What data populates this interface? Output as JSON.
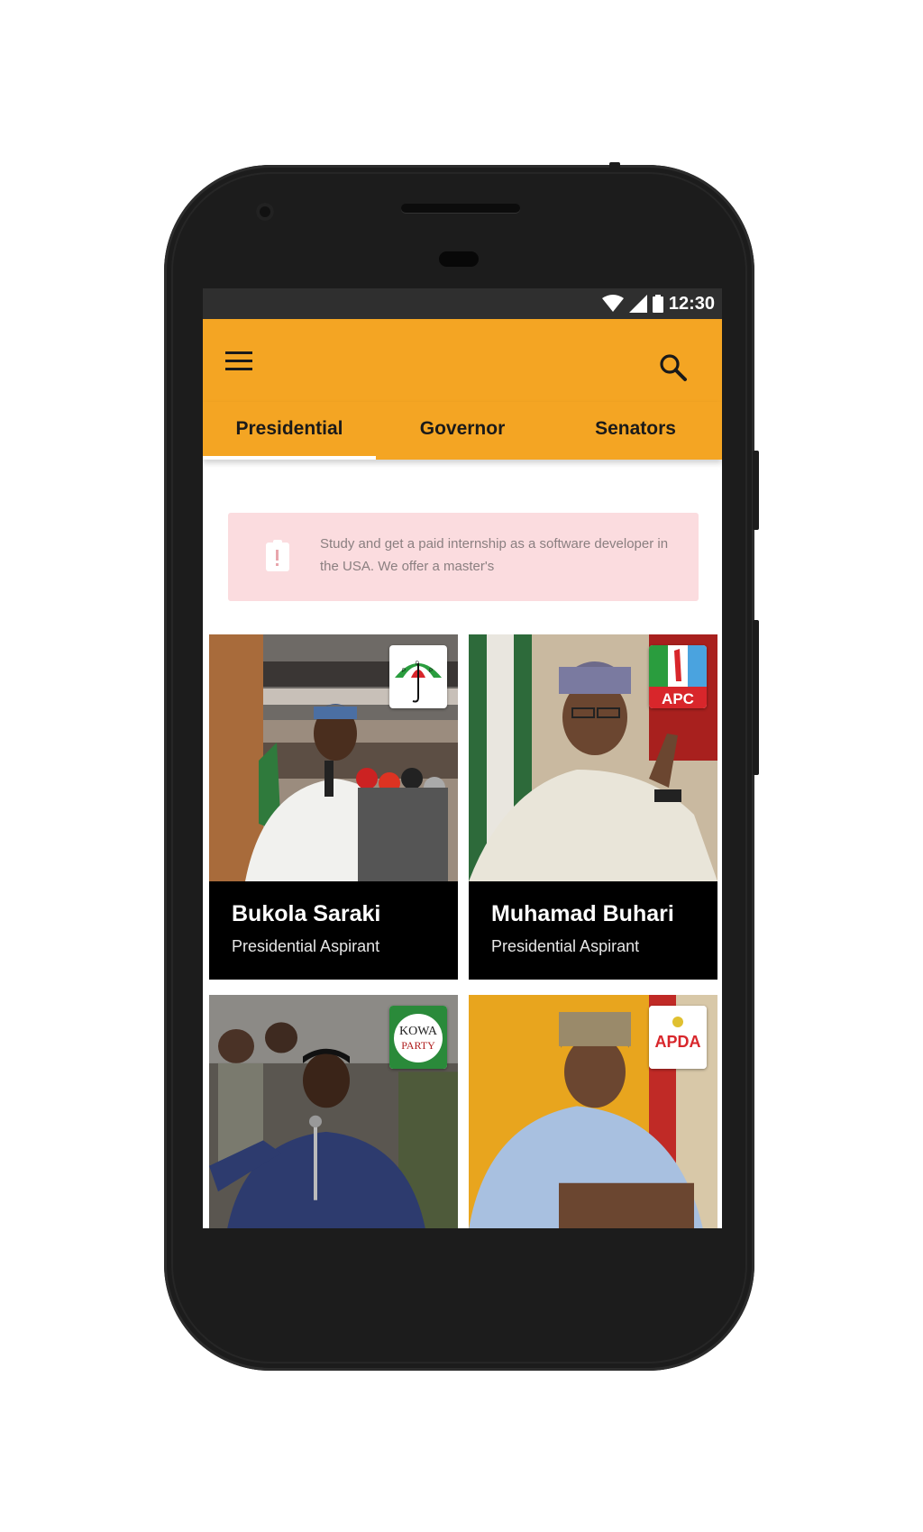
{
  "status_bar": {
    "time": "12:30",
    "icons": [
      "wifi-icon",
      "cell-signal-icon",
      "battery-icon"
    ]
  },
  "app_bar": {
    "background": "#f4a523",
    "menu_icon": "menu-icon",
    "search_icon": "search-icon"
  },
  "tabs": [
    {
      "label": "Presidential",
      "active": true
    },
    {
      "label": "Governor",
      "active": false
    },
    {
      "label": "Senators",
      "active": false
    }
  ],
  "ad": {
    "icon": "alert-clipboard-icon",
    "text": "Study and get a paid internship as a software developer in the USA. We offer a master's"
  },
  "candidates": [
    {
      "name": "Bukola Saraki",
      "role": "Presidential Aspirant",
      "party": "PDP"
    },
    {
      "name": "Muhamad Buhari",
      "role": "Presidential Aspirant",
      "party": "APC"
    },
    {
      "name": "",
      "role": "",
      "party": "KOWA PARTY",
      "party_line1": "KOWA",
      "party_line2": "PARTY"
    },
    {
      "name": "",
      "role": "",
      "party": "APDA"
    }
  ]
}
